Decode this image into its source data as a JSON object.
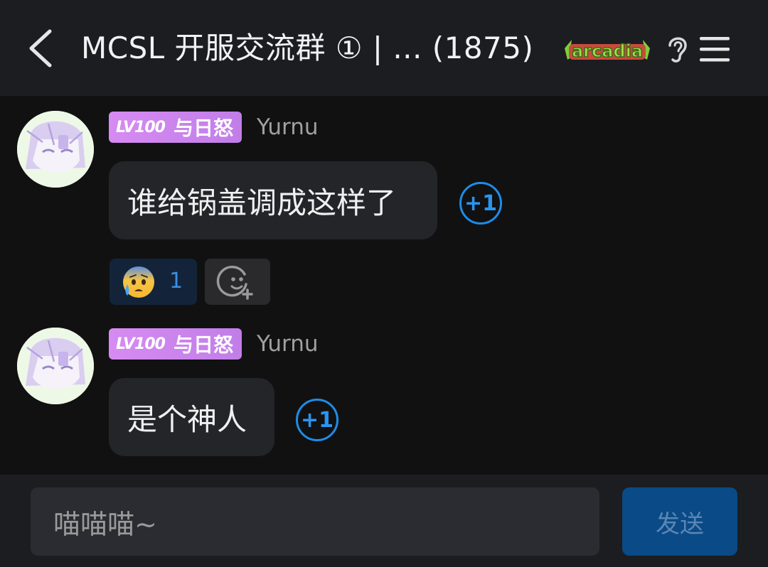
{
  "header": {
    "title": "MCSL 开服交流群 ① | ... (1875)",
    "badge_logo_text": "arcadia",
    "icons": [
      "back-arrow-icon",
      "ear-icon",
      "menu-icon"
    ]
  },
  "messages": [
    {
      "badge_level": "LV100",
      "badge_title": "与日怒",
      "username": "Yurnu",
      "text": "谁给锅盖调成这样了",
      "plus_one": "+1",
      "reactions": [
        {
          "emoji": "anxious-face-with-sweat",
          "count": "1"
        }
      ]
    },
    {
      "badge_level": "LV100",
      "badge_title": "与日怒",
      "username": "Yurnu",
      "text": "是个神人",
      "plus_one": "+1"
    }
  ],
  "composer": {
    "value": "喵喵喵~",
    "send_label": "发送"
  },
  "colors": {
    "background": "#111111",
    "header": "#1b1d21",
    "bubble": "#232529",
    "accent": "#1e8ce8",
    "badge": "#d08af0",
    "send_button": "#0a4a86"
  }
}
